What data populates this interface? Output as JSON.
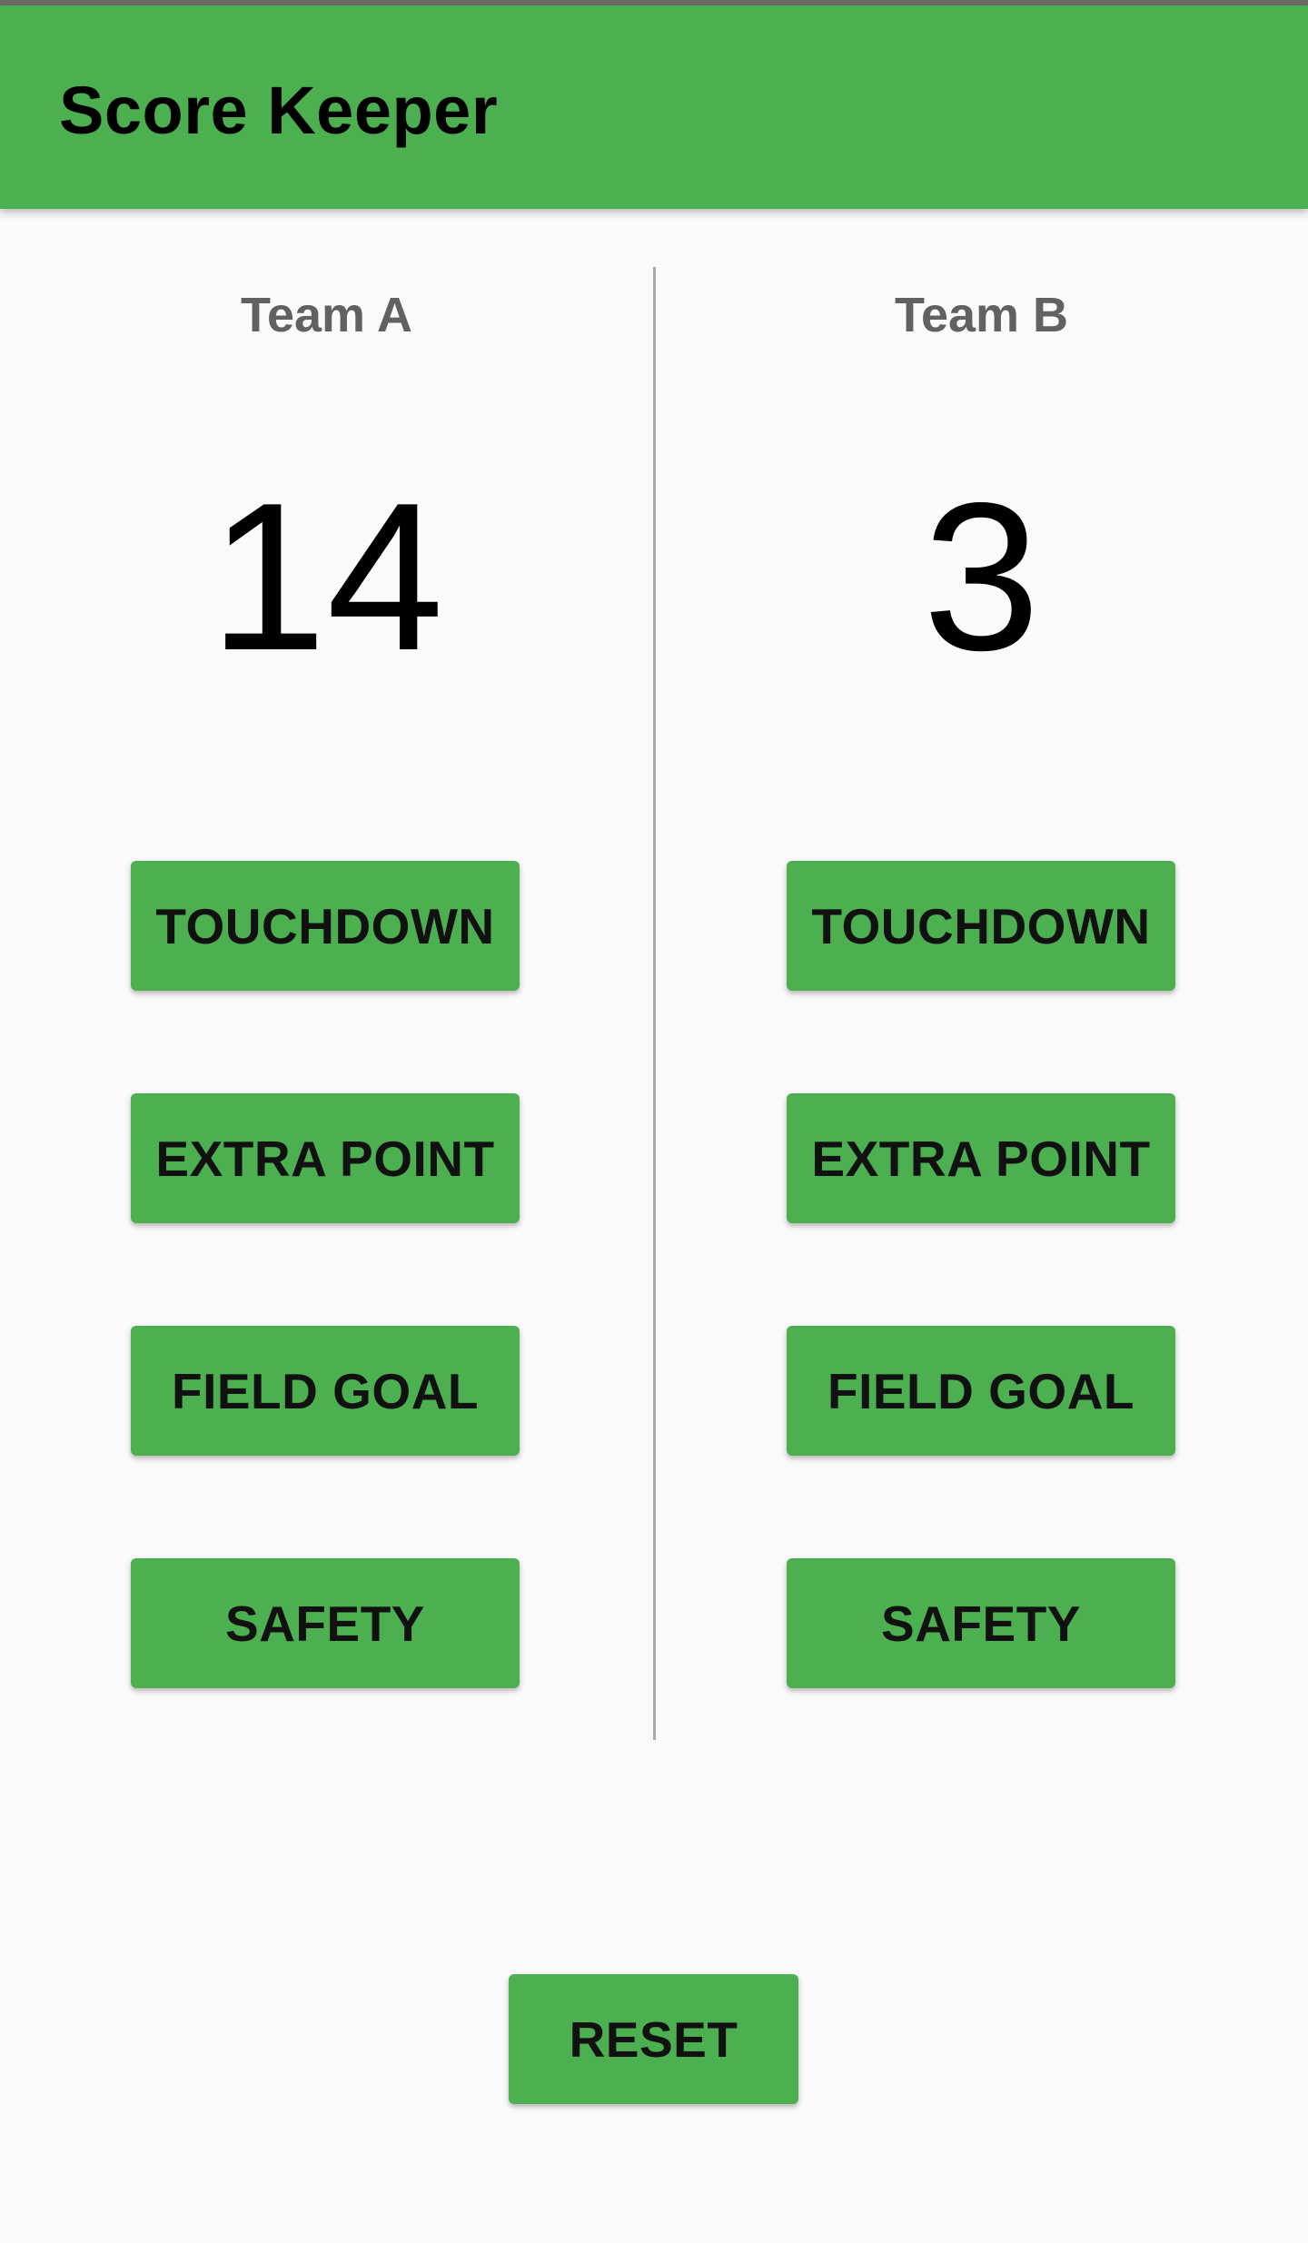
{
  "app": {
    "title": "Score Keeper",
    "colors": {
      "primary": "#4caf50",
      "background": "#fafafa",
      "status_strip": "#6b6b6b",
      "divider": "#a8a8a8"
    }
  },
  "team_a": {
    "name": "Team A",
    "score": "14",
    "buttons": {
      "touchdown": "TOUCHDOWN",
      "extra_point": "EXTRA POINT",
      "field_goal": "FIELD GOAL",
      "safety": "SAFETY"
    }
  },
  "team_b": {
    "name": "Team B",
    "score": "3",
    "buttons": {
      "touchdown": "TOUCHDOWN",
      "extra_point": "EXTRA POINT",
      "field_goal": "FIELD GOAL",
      "safety": "SAFETY"
    }
  },
  "reset_label": "RESET"
}
